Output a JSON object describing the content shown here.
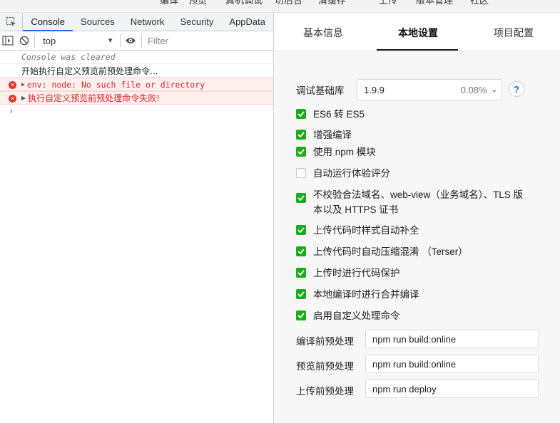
{
  "topbar": {
    "items": [
      "编译",
      "预览",
      "真机调试",
      "切后台",
      "清缓存",
      "上传",
      "版本管理",
      "社区"
    ]
  },
  "devtools": {
    "tabs": [
      "Console",
      "Sources",
      "Network",
      "Security",
      "AppData"
    ],
    "active_tab": "Console",
    "context": "top",
    "filter_placeholder": "Filter",
    "lines": [
      {
        "type": "muted",
        "text": "Console was cleared"
      },
      {
        "type": "plain",
        "text": "开始执行自定义预览前预处理命令..."
      },
      {
        "type": "error",
        "text": "env: node: No such file or directory"
      },
      {
        "type": "error",
        "text": "执行自定义预览前预处理命令失败!"
      }
    ],
    "prompt": "›",
    "colors": {
      "accent": "#1a73e8",
      "error": "#e02020"
    }
  },
  "settings": {
    "tabs": [
      "基本信息",
      "本地设置",
      "项目配置"
    ],
    "active_tab": "本地设置",
    "lib_label": "调试基础库",
    "lib_version": "1.9.9",
    "lib_usage": "0.08%",
    "help": "?",
    "checkboxes": [
      {
        "label": "ES6 转 ES5",
        "checked": true
      },
      {
        "label": "增强编译",
        "checked": true
      },
      {
        "label": "使用 npm 模块",
        "checked": true
      },
      {
        "label": "自动运行体验评分",
        "checked": false
      },
      {
        "label": "不校验合法域名、web-view（业务域名）、TLS 版",
        "label2": "本以及 HTTPS 证书",
        "checked": true
      },
      {
        "label": "上传代码时样式自动补全",
        "checked": true
      },
      {
        "label": "上传代码时自动压缩混淆 （Terser）",
        "checked": true
      },
      {
        "label": "上传时进行代码保护",
        "checked": true
      },
      {
        "label": "本地编译时进行合并编译",
        "checked": true
      },
      {
        "label": "启用自定义处理命令",
        "checked": true
      }
    ],
    "commands": [
      {
        "label": "编译前预处理",
        "value": "npm run build:online"
      },
      {
        "label": "预览前预处理",
        "value": "npm run build:online"
      },
      {
        "label": "上传前预处理",
        "value": "npm run deploy"
      }
    ],
    "colors": {
      "check": "#1aad19"
    }
  }
}
